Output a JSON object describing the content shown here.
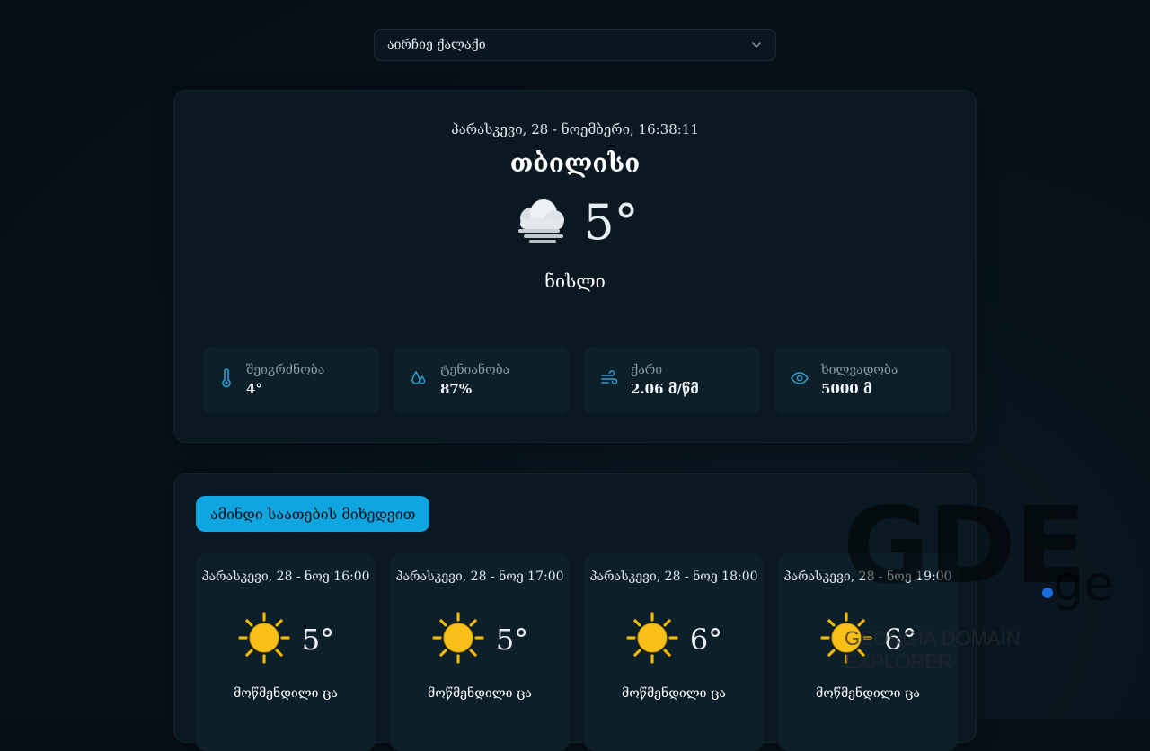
{
  "city_select": {
    "value": "აირჩიე ქალაქი"
  },
  "current": {
    "datetime": "პარასკევი, 28 - ნოემბერი, 16:38:11",
    "city": "თბილისი",
    "temp": "5°",
    "condition": "ნისლი",
    "icon": "fog-cloud-icon",
    "stats": [
      {
        "label": "შეიგრძნობა",
        "value": "4°",
        "icon": "thermometer-icon"
      },
      {
        "label": "ტენიანობა",
        "value": "87%",
        "icon": "humidity-drops-icon"
      },
      {
        "label": "ქარი",
        "value": "2.06 მ/წმ",
        "icon": "wind-icon"
      },
      {
        "label": "ხილვადობა",
        "value": "5000 მ",
        "icon": "eye-icon"
      }
    ]
  },
  "hourly": {
    "tab_label": "ამინდი საათების მიხედვით",
    "items": [
      {
        "time": "პარასკევი, 28 - ნოე 16:00",
        "temp": "5°",
        "desc": "მოწმენდილი ცა",
        "icon": "sun-icon"
      },
      {
        "time": "პარასკევი, 28 - ნოე 17:00",
        "temp": "5°",
        "desc": "მოწმენდილი ცა",
        "icon": "sun-icon"
      },
      {
        "time": "პარასკევი, 28 - ნოე 18:00",
        "temp": "6°",
        "desc": "მოწმენდილი ცა",
        "icon": "sun-icon"
      },
      {
        "time": "პარასკევი, 28 - ნოე 19:00",
        "temp": "6°",
        "desc": "მოწმენდილი ცა",
        "icon": "sun-icon"
      }
    ]
  },
  "watermark": {
    "letters": "GDE",
    "suffix": "ge",
    "subtitle": "GEORGIA DOMAIN EXPLORER"
  },
  "colors": {
    "accent": "#0ea5e0",
    "icon_blue": "#2aa3d6",
    "sun": "#f5b800",
    "card": "#0a1821",
    "tile": "#0d1f29"
  }
}
